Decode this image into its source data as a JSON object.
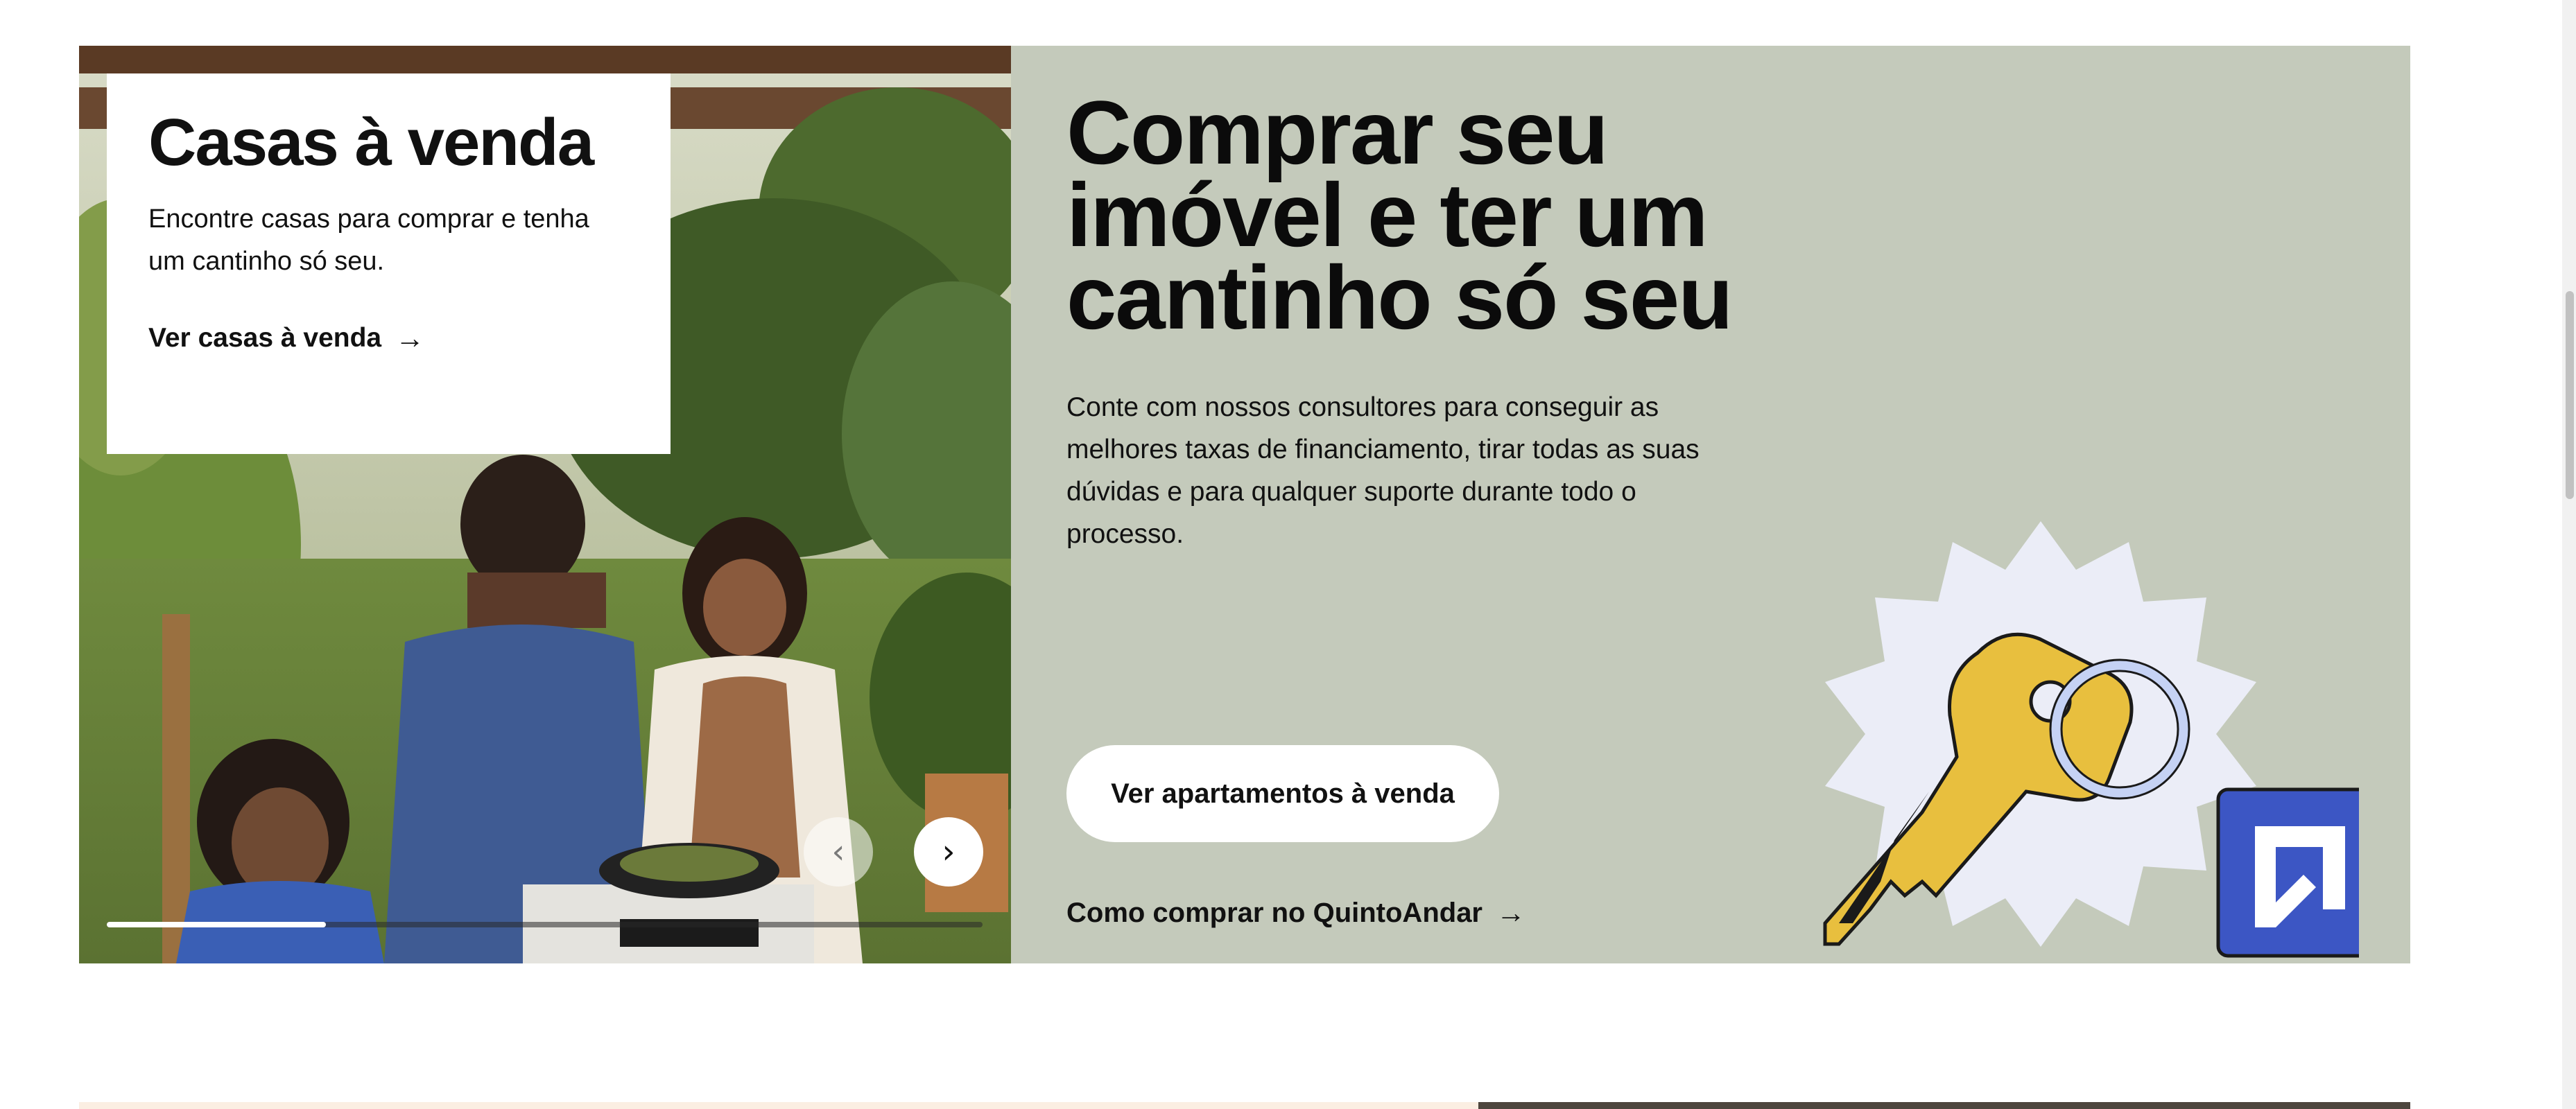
{
  "card": {
    "title": "Casas à venda",
    "text": "Encontre casas para comprar e tenha um cantinho só seu.",
    "link_label": "Ver casas à venda",
    "link_icon": "arrow-right-icon"
  },
  "carousel": {
    "prev_icon": "chevron-left-icon",
    "next_icon": "chevron-right-icon",
    "progress": 0.25
  },
  "hero": {
    "headline": "Comprar seu imóvel e ter um cantinho só seu",
    "description": "Conte com nossos consultores para conseguir as melhores taxas de financiamento, tirar todas as suas dúvidas e para qualquer suporte durante todo o processo.",
    "cta_label": "Ver apartamentos à venda",
    "how_link_label": "Como comprar no QuintoAndar",
    "how_link_icon": "arrow-right-icon"
  },
  "illustration": {
    "icon": "key-with-house-keychain-icon"
  },
  "colors": {
    "section_bg": "#c4cabb",
    "brand_blue": "#3c56c4",
    "key_yellow": "#e8bf3e",
    "badge_bg": "#ebedf7"
  }
}
